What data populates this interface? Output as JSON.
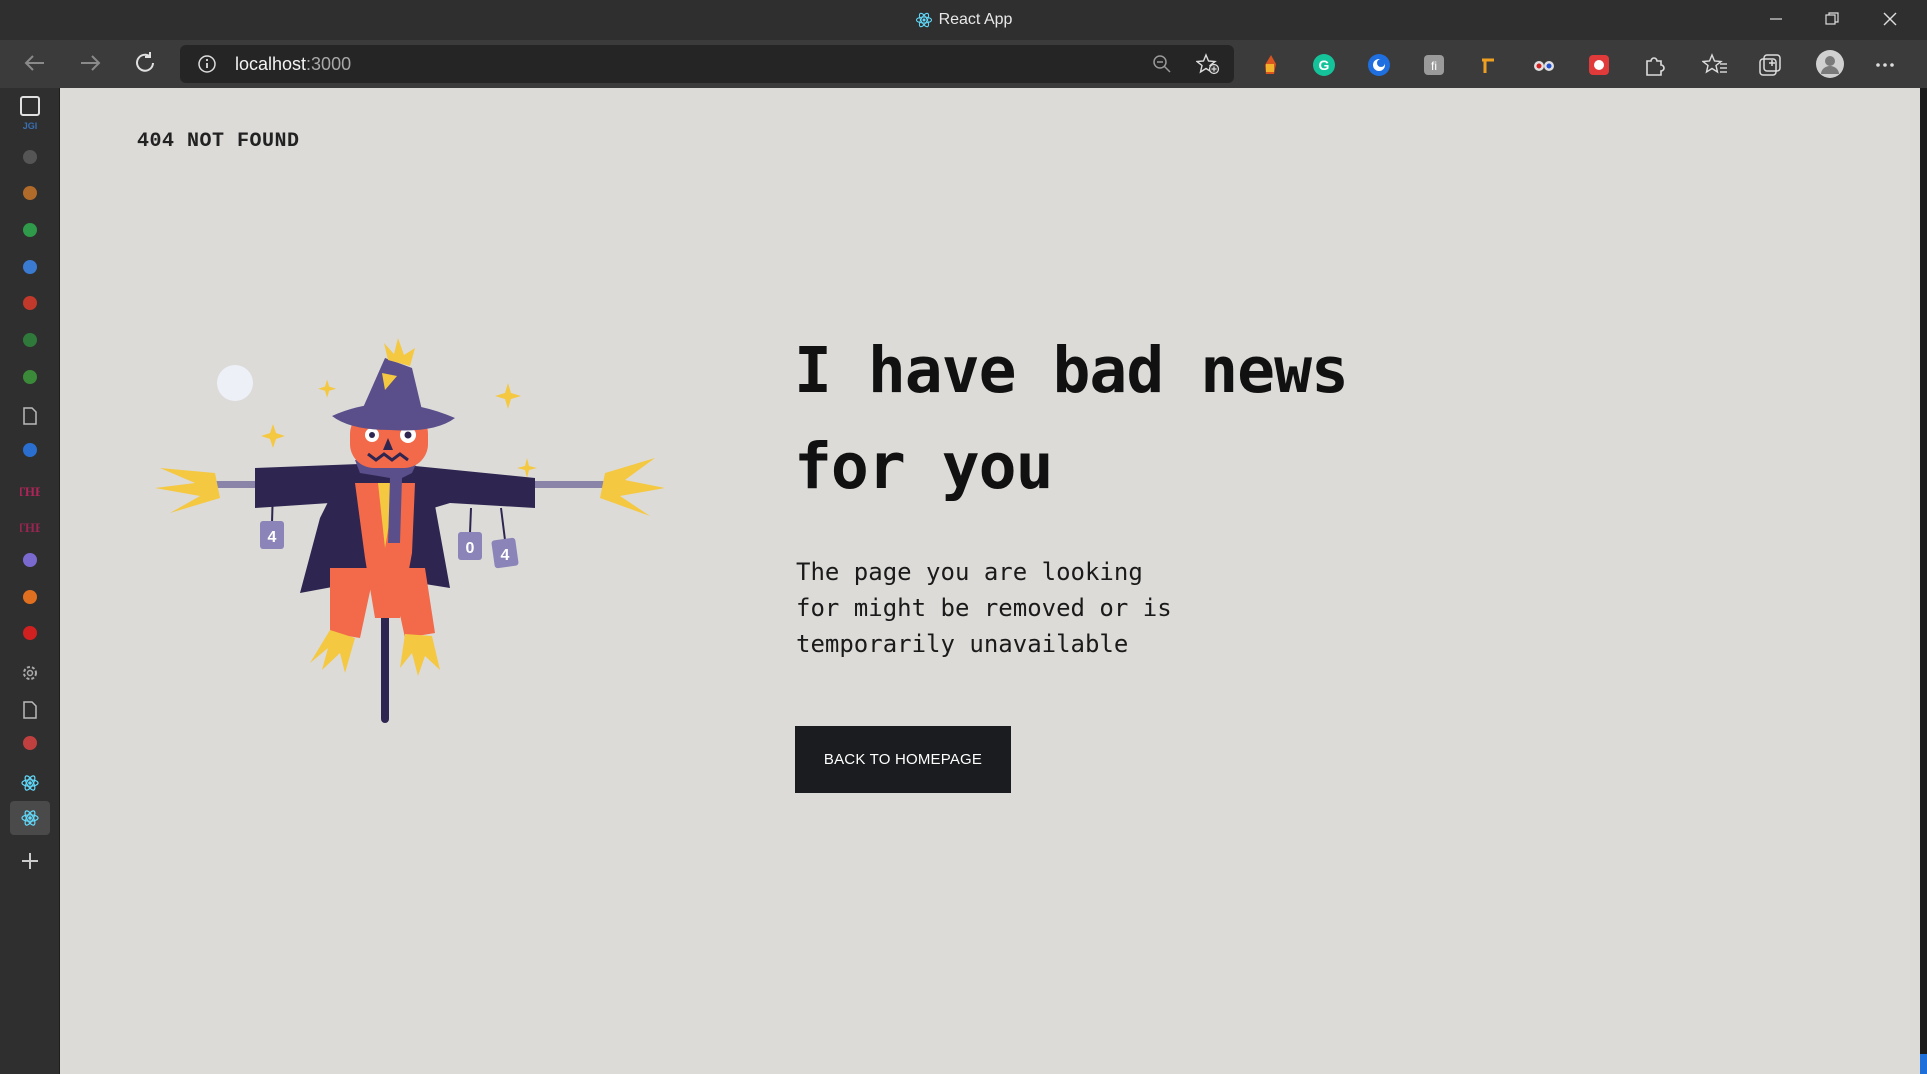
{
  "window": {
    "title": "React App"
  },
  "toolbar": {
    "url_host": "localhost",
    "url_port": ":3000"
  },
  "sidebar": {
    "items": [
      {
        "icon": "tabs-icon",
        "color": "#e0e0e0"
      },
      {
        "icon": "jgi-icon",
        "color": "#3a6fb0"
      },
      {
        "icon": "dark-circle-icon",
        "color": "#555555"
      },
      {
        "icon": "orange-globe-icon",
        "color": "#b06a2a"
      },
      {
        "icon": "drive-icon",
        "color": "#2e9a4a"
      },
      {
        "icon": "drive-icon",
        "color": "#3a7ad0"
      },
      {
        "icon": "chrome-like-icon",
        "color": "#c0392b"
      },
      {
        "icon": "green-gear-icon",
        "color": "#2f7a3a"
      },
      {
        "icon": "green-gear-icon",
        "color": "#3a8a3a"
      },
      {
        "icon": "document-icon",
        "color": "#bbbbbb"
      },
      {
        "icon": "blue-circle-icon",
        "color": "#2a6fd0"
      },
      {
        "icon": "the-icon",
        "color": "#b0245a"
      },
      {
        "icon": "the-icon",
        "color": "#9a2452"
      },
      {
        "icon": "purple-dot-icon",
        "color": "#7a6ad0"
      },
      {
        "icon": "flame-icon",
        "color": "#e07020"
      },
      {
        "icon": "youtube-icon",
        "color": "#d02020"
      },
      {
        "icon": "settings-icon",
        "color": "#aaaaaa"
      },
      {
        "icon": "document-icon",
        "color": "#bbbbbb"
      },
      {
        "icon": "red-folder-icon",
        "color": "#c04040"
      },
      {
        "icon": "react-icon",
        "color": "#61dafb"
      },
      {
        "icon": "react-icon",
        "color": "#61dafb"
      },
      {
        "icon": "plus-icon",
        "color": "#cccccc"
      }
    ]
  },
  "page": {
    "brand": "404 NOT FOUND",
    "headline_line1": "I have bad news",
    "headline_line2": "for you",
    "subtext": "The page you are looking\nfor might be removed or is\ntemporarily unavailable",
    "cta_label": "BACK TO HOMEPAGE",
    "illustration": "scarecrow-404-illustration",
    "can_labels": [
      "4",
      "0",
      "4"
    ]
  },
  "colors": {
    "page_bg": "#dcdbd8",
    "button_bg": "#1b1c1f",
    "scarecrow_coat": "#2e2650",
    "scarecrow_face": "#f26a4a",
    "straw": "#f5c842"
  }
}
